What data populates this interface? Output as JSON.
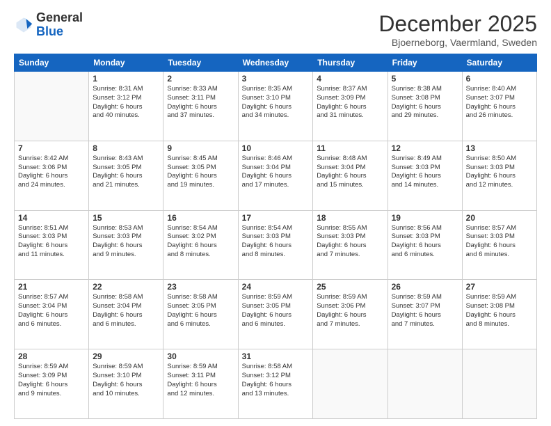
{
  "logo": {
    "general": "General",
    "blue": "Blue"
  },
  "title": {
    "month": "December 2025",
    "location": "Bjoerneborg, Vaermland, Sweden"
  },
  "header_days": [
    "Sunday",
    "Monday",
    "Tuesday",
    "Wednesday",
    "Thursday",
    "Friday",
    "Saturday"
  ],
  "weeks": [
    [
      {
        "day": "",
        "info": ""
      },
      {
        "day": "1",
        "info": "Sunrise: 8:31 AM\nSunset: 3:12 PM\nDaylight: 6 hours\nand 40 minutes."
      },
      {
        "day": "2",
        "info": "Sunrise: 8:33 AM\nSunset: 3:11 PM\nDaylight: 6 hours\nand 37 minutes."
      },
      {
        "day": "3",
        "info": "Sunrise: 8:35 AM\nSunset: 3:10 PM\nDaylight: 6 hours\nand 34 minutes."
      },
      {
        "day": "4",
        "info": "Sunrise: 8:37 AM\nSunset: 3:09 PM\nDaylight: 6 hours\nand 31 minutes."
      },
      {
        "day": "5",
        "info": "Sunrise: 8:38 AM\nSunset: 3:08 PM\nDaylight: 6 hours\nand 29 minutes."
      },
      {
        "day": "6",
        "info": "Sunrise: 8:40 AM\nSunset: 3:07 PM\nDaylight: 6 hours\nand 26 minutes."
      }
    ],
    [
      {
        "day": "7",
        "info": "Sunrise: 8:42 AM\nSunset: 3:06 PM\nDaylight: 6 hours\nand 24 minutes."
      },
      {
        "day": "8",
        "info": "Sunrise: 8:43 AM\nSunset: 3:05 PM\nDaylight: 6 hours\nand 21 minutes."
      },
      {
        "day": "9",
        "info": "Sunrise: 8:45 AM\nSunset: 3:05 PM\nDaylight: 6 hours\nand 19 minutes."
      },
      {
        "day": "10",
        "info": "Sunrise: 8:46 AM\nSunset: 3:04 PM\nDaylight: 6 hours\nand 17 minutes."
      },
      {
        "day": "11",
        "info": "Sunrise: 8:48 AM\nSunset: 3:04 PM\nDaylight: 6 hours\nand 15 minutes."
      },
      {
        "day": "12",
        "info": "Sunrise: 8:49 AM\nSunset: 3:03 PM\nDaylight: 6 hours\nand 14 minutes."
      },
      {
        "day": "13",
        "info": "Sunrise: 8:50 AM\nSunset: 3:03 PM\nDaylight: 6 hours\nand 12 minutes."
      }
    ],
    [
      {
        "day": "14",
        "info": "Sunrise: 8:51 AM\nSunset: 3:03 PM\nDaylight: 6 hours\nand 11 minutes."
      },
      {
        "day": "15",
        "info": "Sunrise: 8:53 AM\nSunset: 3:03 PM\nDaylight: 6 hours\nand 9 minutes."
      },
      {
        "day": "16",
        "info": "Sunrise: 8:54 AM\nSunset: 3:02 PM\nDaylight: 6 hours\nand 8 minutes."
      },
      {
        "day": "17",
        "info": "Sunrise: 8:54 AM\nSunset: 3:03 PM\nDaylight: 6 hours\nand 8 minutes."
      },
      {
        "day": "18",
        "info": "Sunrise: 8:55 AM\nSunset: 3:03 PM\nDaylight: 6 hours\nand 7 minutes."
      },
      {
        "day": "19",
        "info": "Sunrise: 8:56 AM\nSunset: 3:03 PM\nDaylight: 6 hours\nand 6 minutes."
      },
      {
        "day": "20",
        "info": "Sunrise: 8:57 AM\nSunset: 3:03 PM\nDaylight: 6 hours\nand 6 minutes."
      }
    ],
    [
      {
        "day": "21",
        "info": "Sunrise: 8:57 AM\nSunset: 3:04 PM\nDaylight: 6 hours\nand 6 minutes."
      },
      {
        "day": "22",
        "info": "Sunrise: 8:58 AM\nSunset: 3:04 PM\nDaylight: 6 hours\nand 6 minutes."
      },
      {
        "day": "23",
        "info": "Sunrise: 8:58 AM\nSunset: 3:05 PM\nDaylight: 6 hours\nand 6 minutes."
      },
      {
        "day": "24",
        "info": "Sunrise: 8:59 AM\nSunset: 3:05 PM\nDaylight: 6 hours\nand 6 minutes."
      },
      {
        "day": "25",
        "info": "Sunrise: 8:59 AM\nSunset: 3:06 PM\nDaylight: 6 hours\nand 7 minutes."
      },
      {
        "day": "26",
        "info": "Sunrise: 8:59 AM\nSunset: 3:07 PM\nDaylight: 6 hours\nand 7 minutes."
      },
      {
        "day": "27",
        "info": "Sunrise: 8:59 AM\nSunset: 3:08 PM\nDaylight: 6 hours\nand 8 minutes."
      }
    ],
    [
      {
        "day": "28",
        "info": "Sunrise: 8:59 AM\nSunset: 3:09 PM\nDaylight: 6 hours\nand 9 minutes."
      },
      {
        "day": "29",
        "info": "Sunrise: 8:59 AM\nSunset: 3:10 PM\nDaylight: 6 hours\nand 10 minutes."
      },
      {
        "day": "30",
        "info": "Sunrise: 8:59 AM\nSunset: 3:11 PM\nDaylight: 6 hours\nand 12 minutes."
      },
      {
        "day": "31",
        "info": "Sunrise: 8:58 AM\nSunset: 3:12 PM\nDaylight: 6 hours\nand 13 minutes."
      },
      {
        "day": "",
        "info": ""
      },
      {
        "day": "",
        "info": ""
      },
      {
        "day": "",
        "info": ""
      }
    ]
  ]
}
